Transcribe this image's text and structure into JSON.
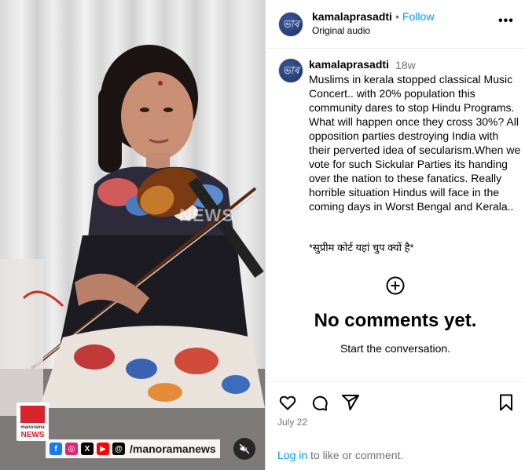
{
  "video": {
    "watermark": "NEWS",
    "channel_logo_line1": "manorama",
    "channel_logo_line2": "NEWS",
    "social_handle": "/manoramanews",
    "social_icons": [
      "facebook-icon",
      "instagram-icon",
      "x-icon",
      "youtube-icon",
      "threads-icon"
    ],
    "muted": true
  },
  "header": {
    "avatar_text": "ভাৰ",
    "username": "kamalaprasadti",
    "separator": "•",
    "follow_label": "Follow",
    "audio_label": "Original audio",
    "more_label": "•••"
  },
  "caption": {
    "avatar_text": "ভাৰ",
    "username": "kamalaprasadti",
    "time": "18w",
    "text": "Muslims in kerala stopped classical Music Concert.. with 20% population this community dares to stop Hindu Programs. What will happen once they cross 30%? All opposition parties destroying India with their perverted idea of secularism.When we vote for such Sickular Parties its handing over the nation to these fanatics. Really horrible situation Hindus will face in the coming days in Worst Bengal and Kerala..",
    "hindi_line": "*सुप्रीम कोर्ट यहां चुप क्यों है*"
  },
  "comments": {
    "empty_title": "No comments yet.",
    "empty_subtitle": "Start the conversation."
  },
  "footer": {
    "date": "July 22",
    "login_link": "Log in",
    "login_rest": " to like or comment."
  },
  "colors": {
    "link_blue": "#0095f6",
    "muted_gray": "#737373",
    "divider": "#dbdbdb"
  }
}
